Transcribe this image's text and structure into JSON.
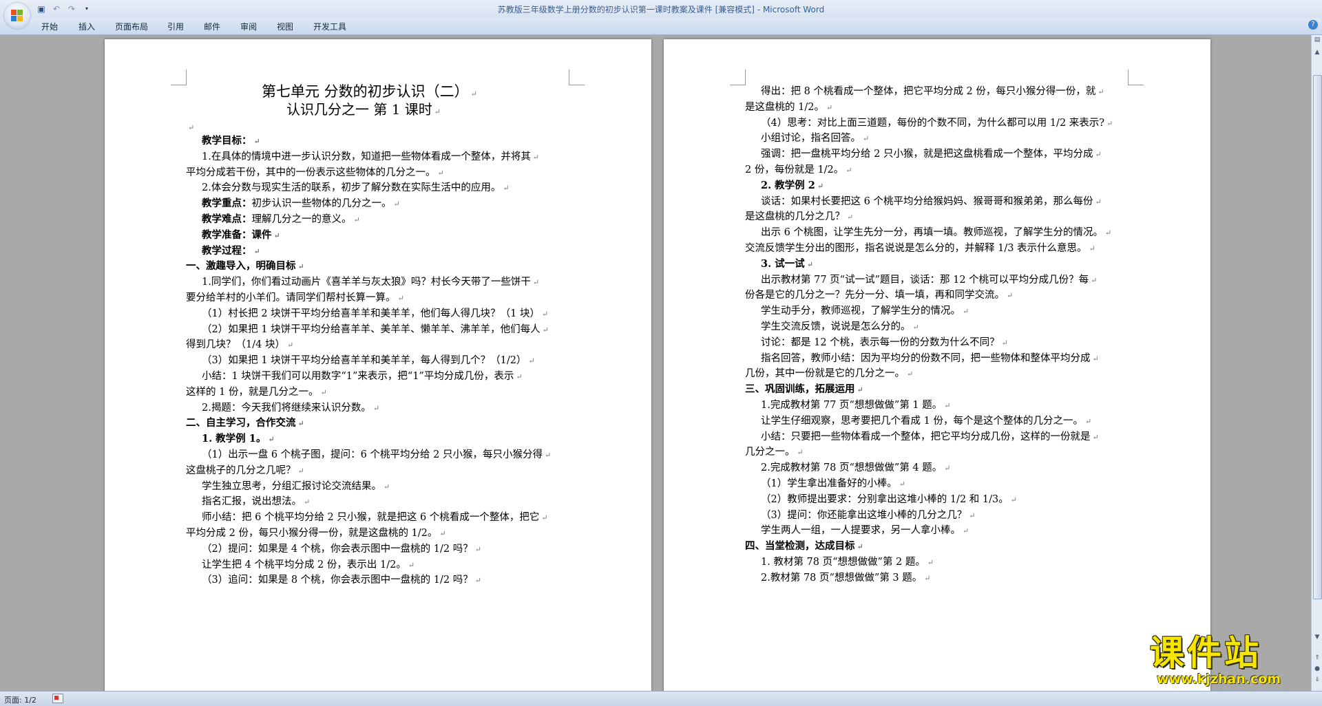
{
  "window": {
    "doc_name": "苏教版三年级数学上册分数的初步认识第一课时教案及课件 [兼容模式]",
    "separator": " - ",
    "app_name": "Microsoft Word"
  },
  "ribbon": {
    "tabs": [
      "开始",
      "插入",
      "页面布局",
      "引用",
      "邮件",
      "审阅",
      "视图",
      "开发工具"
    ]
  },
  "statusbar": {
    "page_label": "页面: 1/2"
  },
  "watermark": {
    "big": "课件站",
    "url": "www.kjzhan.com"
  },
  "colors": {
    "ribbon": "#dfe8f5",
    "workspace": "#a9a9a9",
    "watermark": "#f7e400"
  },
  "left_page": {
    "lines": [
      {
        "text": "第七单元 分数的初步认识（二）",
        "style": "t1"
      },
      {
        "text": "认识几分之一         第 1 课时",
        "style": "t2"
      },
      {
        "text": "",
        "style": "blank"
      },
      {
        "text": "教学目标：",
        "style": "ind b"
      },
      {
        "text": "1.在具体的情境中进一步认识分数，知道把一些物体看成一个整体，并将其",
        "style": "ind"
      },
      {
        "text": "平均分成若干份，其中的一份表示这些物体的几分之一。",
        "style": ""
      },
      {
        "text": "2.体会分数与现实生活的联系，初步了解分数在实际生活中的应用。",
        "style": "ind"
      },
      {
        "text": "教学重点：初步认识一些物体的几分之一。",
        "style": "ind",
        "bold_prefix": "教学重点："
      },
      {
        "text": "教学难点：理解几分之一的意义。",
        "style": "ind",
        "bold_prefix": "教学难点："
      },
      {
        "text": "教学准备：课件",
        "style": "ind b"
      },
      {
        "text": "教学过程：",
        "style": "ind b"
      },
      {
        "text": "一、激趣导入，明确目标",
        "style": "b"
      },
      {
        "text": "1.同学们，你们看过动画片《喜羊羊与灰太狼》吗？村长今天带了一些饼干",
        "style": "ind"
      },
      {
        "text": "要分给羊村的小羊们。请同学们帮村长算一算。",
        "style": ""
      },
      {
        "text": "（1）村长把 2 块饼干平均分给喜羊羊和美羊羊，他们每人得几块？（1 块）",
        "style": "ind"
      },
      {
        "text": "（2）如果把 1 块饼干平均分给喜羊羊、美羊羊、懒羊羊、沸羊羊，他们每人",
        "style": "ind"
      },
      {
        "text": "得到几块？（1/4 块）",
        "style": ""
      },
      {
        "text": "（3）如果把 1 块饼干平均分给喜羊羊和美羊羊，每人得到几个？（1/2）",
        "style": "ind"
      },
      {
        "text": "小结：1 块饼干我们可以用数字“1”来表示，把“1”平均分成几份，表示",
        "style": "ind"
      },
      {
        "text": "这样的 1 份，就是几分之一。",
        "style": ""
      },
      {
        "text": "2.揭题：今天我们将继续来认识分数。",
        "style": "ind"
      },
      {
        "text": "二、自主学习，合作交流",
        "style": "b"
      },
      {
        "text": "1. 教学例 1。",
        "style": "ind b"
      },
      {
        "text": "（1）出示一盘 6 个桃子图，提问：6 个桃平均分给 2 只小猴，每只小猴分得",
        "style": "ind"
      },
      {
        "text": "这盘桃子的几分之几呢？",
        "style": ""
      },
      {
        "text": "学生独立思考，分组汇报讨论交流结果。",
        "style": "ind"
      },
      {
        "text": "指名汇报，说出想法。",
        "style": "ind"
      },
      {
        "text": "师小结：把 6 个桃平均分给 2 只小猴，就是把这 6 个桃看成一个整体，把它",
        "style": "ind"
      },
      {
        "text": "平均分成 2 份，每只小猴分得一份，就是这盘桃的 1/2。",
        "style": ""
      },
      {
        "text": "（2）提问：如果是 4 个桃，你会表示图中一盘桃的 1/2 吗？",
        "style": "ind"
      },
      {
        "text": "让学生把 4 个桃平均分成 2 份，表示出 1/2。",
        "style": "ind"
      },
      {
        "text": "（3）追问：如果是 8 个桃，你会表示图中一盘桃的 1/2 吗？",
        "style": "ind"
      }
    ]
  },
  "right_page": {
    "lines": [
      {
        "text": "得出：把 8 个桃看成一个整体，把它平均分成 2 份，每只小猴分得一份，就",
        "style": "ind"
      },
      {
        "text": "是这盘桃的 1/2。",
        "style": ""
      },
      {
        "text": "（4）思考：对比上面三道题，每份的个数不同，为什么都可以用 1/2 来表示?",
        "style": "ind"
      },
      {
        "text": "小组讨论，指名回答。",
        "style": "ind"
      },
      {
        "text": "强调：把一盘桃平均分给 2 只小猴，就是把这盘桃看成一个整体，平均分成",
        "style": "ind"
      },
      {
        "text": "2 份，每份就是 1/2。",
        "style": ""
      },
      {
        "text": "2. 教学例 2",
        "style": "ind b"
      },
      {
        "text": "谈话：如果村长要把这 6 个桃平均分给猴妈妈、猴哥哥和猴弟弟，那么每份",
        "style": "ind"
      },
      {
        "text": "是这盘桃的几分之几？",
        "style": ""
      },
      {
        "text": "出示 6 个桃图，让学生先分一分，再填一填。教师巡视，了解学生分的情况。",
        "style": "ind"
      },
      {
        "text": "交流反馈学生分出的图形，指名说说是怎么分的，并解释 1/3 表示什么意思。",
        "style": ""
      },
      {
        "text": "3. 试一试",
        "style": "ind b"
      },
      {
        "text": "出示教材第 77 页“试一试”题目，谈话：那 12 个桃可以平均分成几份？每",
        "style": "ind"
      },
      {
        "text": "份各是它的几分之一？先分一分、填一填，再和同学交流。",
        "style": ""
      },
      {
        "text": "学生动手分，教师巡视，了解学生分的情况。",
        "style": "ind"
      },
      {
        "text": "学生交流反馈，说说是怎么分的。",
        "style": "ind"
      },
      {
        "text": "讨论：都是 12 个桃，表示每一份的分数为什么不同？",
        "style": "ind"
      },
      {
        "text": "指名回答，教师小结：因为平均分的份数不同，把一些物体和整体平均分成",
        "style": "ind"
      },
      {
        "text": "几份，其中一份就是它的几分之一。",
        "style": ""
      },
      {
        "text": "三、巩固训练，拓展运用",
        "style": "b"
      },
      {
        "text": "1.完成教材第 77 页“想想做做”第 1 题。",
        "style": "ind"
      },
      {
        "text": "让学生仔细观察，思考要把几个看成 1 份，每个是这个整体的几分之一。",
        "style": "ind"
      },
      {
        "text": " 小结：只要把一些物体看成一个整体，把它平均分成几份，这样的一份就是",
        "style": "ind"
      },
      {
        "text": "几分之一。",
        "style": ""
      },
      {
        "text": "2.完成教材第 78 页“想想做做”第 4 题。",
        "style": "ind"
      },
      {
        "text": "（1）学生拿出准备好的小棒。",
        "style": "ind"
      },
      {
        "text": "（2）教师提出要求：分别拿出这堆小棒的 1/2 和 1/3。",
        "style": "ind"
      },
      {
        "text": "（3）提问：你还能拿出这堆小棒的几分之几？",
        "style": "ind"
      },
      {
        "text": "学生两人一组，一人提要求，另一人拿小棒。",
        "style": "ind"
      },
      {
        "text": "四、当堂检测，达成目标",
        "style": "b"
      },
      {
        "text": "1. 教材第 78 页“想想做做”第 2 题。",
        "style": "ind"
      },
      {
        "text": "2.教材第 78 页“想想做做”第 3 题。",
        "style": "ind"
      }
    ]
  }
}
